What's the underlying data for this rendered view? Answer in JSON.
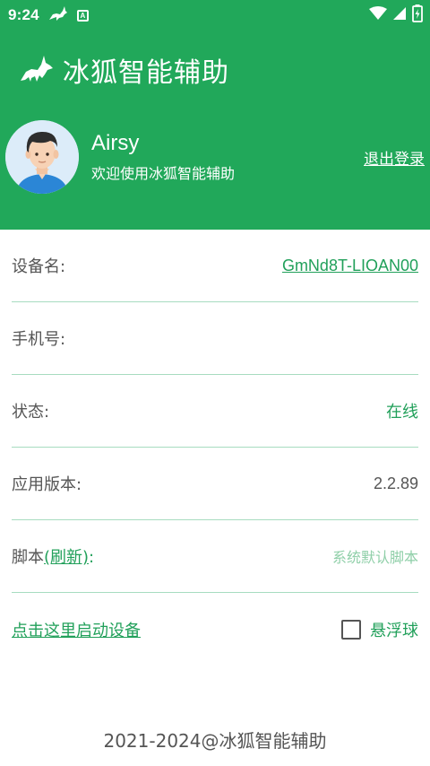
{
  "status_bar": {
    "time": "9:24",
    "notification_icons": [
      "fox-icon",
      "a-badge-icon"
    ],
    "system_icons": [
      "wifi-icon",
      "signal-icon",
      "battery-charging-icon"
    ],
    "badge_letter": "A"
  },
  "header": {
    "app_title": "冰狐智能辅助",
    "logo_icon": "fox-icon",
    "background_color": "#21a85a"
  },
  "profile": {
    "username": "Airsy",
    "welcome": "欢迎使用冰狐智能辅助",
    "logout_label": "退出登录",
    "avatar_icon": "user-avatar"
  },
  "info": {
    "device_name_label": "设备名:",
    "device_name_value": "GmNd8T-LIOAN00",
    "phone_label": "手机号:",
    "phone_value": "",
    "status_label": "状态:",
    "status_value": "在线",
    "version_label": "应用版本:",
    "version_value": "2.2.89",
    "script_label_prefix": "脚本",
    "script_refresh": "(刷新)",
    "script_label_suffix": ":",
    "script_value": "系统默认脚本"
  },
  "actions": {
    "start_device": "点击这里启动设备",
    "float_ball_label": "悬浮球",
    "float_ball_checked": false
  },
  "footer": {
    "copyright": "2021-2024@冰狐智能辅助"
  },
  "colors": {
    "accent": "#21a05a",
    "divider": "#a7dcc0"
  }
}
